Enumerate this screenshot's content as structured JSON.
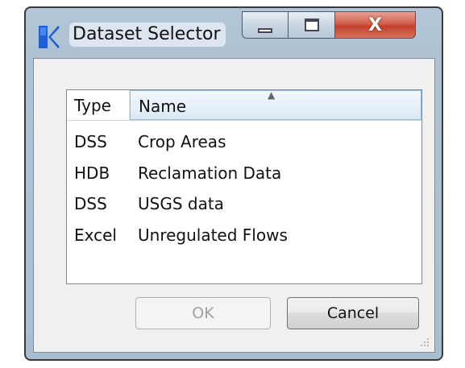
{
  "window": {
    "title": "Dataset Selector",
    "icon": "riverware-app-icon",
    "controls": {
      "minimize": "minimize-icon",
      "maximize": "maximize-icon",
      "close": "X"
    }
  },
  "table": {
    "columns": [
      {
        "label": "Type"
      },
      {
        "label": "Name",
        "sorted": "ascending"
      }
    ],
    "rows": [
      {
        "type": "DSS",
        "name": "Crop Areas"
      },
      {
        "type": "HDB",
        "name": "Reclamation Data"
      },
      {
        "type": "DSS",
        "name": "USGS data"
      },
      {
        "type": "Excel",
        "name": "Unregulated Flows"
      }
    ]
  },
  "buttons": {
    "ok": {
      "label": "OK",
      "enabled": false
    },
    "cancel": {
      "label": "Cancel",
      "enabled": true
    }
  },
  "colors": {
    "frame": "#aec2d4",
    "close": "#c2402b",
    "header_highlight": "#dbe9f5"
  }
}
